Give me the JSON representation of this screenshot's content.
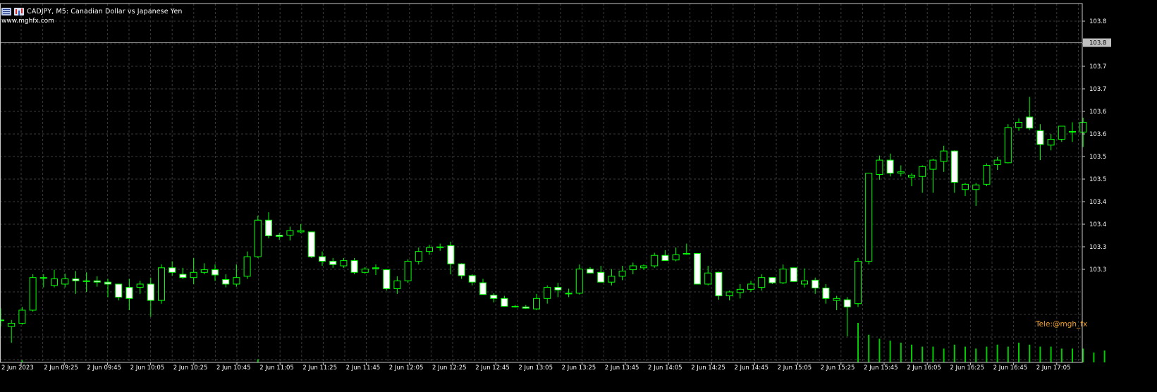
{
  "header": {
    "symbol_title": "CADJPY, M5:  Canadian Dollar vs Japanese Yen",
    "menu_icon": "window-menu-icon",
    "chart_icon": "chart-type-icon"
  },
  "site_label": "www.mghfx.com",
  "watermark": "Tele:@mgh_fx",
  "colors": {
    "background": "#000000",
    "grid": "#3a3a3a",
    "candle_up_fill": "#000000",
    "candle_down_fill": "#ffffff",
    "candle_outline": "#00ff00",
    "volume": "#00cc00",
    "axis_text": "#ffffff",
    "price_tag_bg": "#c0c0c0"
  },
  "price_axis": {
    "labels": [
      "103.8",
      "103.8",
      "103.7",
      "103.7",
      "103.6",
      "103.6",
      "103.5",
      "103.5",
      "103.4",
      "103.4",
      "103.3",
      "103.3"
    ],
    "current_price_label": "103.8"
  },
  "time_axis": {
    "labels": [
      "2 Jun 2023",
      "2 Jun 09:25",
      "2 Jun 09:45",
      "2 Jun 10:05",
      "2 Jun 10:25",
      "2 Jun 10:45",
      "2 Jun 11:05",
      "2 Jun 11:25",
      "2 Jun 11:45",
      "2 Jun 12:05",
      "2 Jun 12:25",
      "2 Jun 12:45",
      "2 Jun 13:05",
      "2 Jun 13:25",
      "2 Jun 13:45",
      "2 Jun 14:05",
      "2 Jun 14:25",
      "2 Jun 14:45",
      "2 Jun 15:05",
      "2 Jun 15:25",
      "2 Jun 15:45",
      "2 Jun 16:05",
      "2 Jun 16:25",
      "2 Jun 16:45",
      "2 Jun 17:05"
    ]
  },
  "chart_data": {
    "type": "candlestick",
    "title": "CADJPY, M5:  Canadian Dollar vs Japanese Yen",
    "ylim": [
      103.29,
      103.84
    ],
    "grid": true,
    "current_price": 103.78,
    "candles": [
      {
        "o": 103.355,
        "h": 103.373,
        "l": 103.345,
        "c": 103.355
      },
      {
        "o": 103.345,
        "h": 103.355,
        "l": 103.32,
        "c": 103.35
      },
      {
        "o": 103.35,
        "h": 103.375,
        "l": 103.348,
        "c": 103.37
      },
      {
        "o": 103.37,
        "h": 103.425,
        "l": 103.368,
        "c": 103.42
      },
      {
        "o": 103.42,
        "h": 103.425,
        "l": 103.405,
        "c": 103.42
      },
      {
        "o": 103.408,
        "h": 103.432,
        "l": 103.405,
        "c": 103.418
      },
      {
        "o": 103.41,
        "h": 103.426,
        "l": 103.405,
        "c": 103.418
      },
      {
        "o": 103.418,
        "h": 103.43,
        "l": 103.395,
        "c": 103.415
      },
      {
        "o": 103.415,
        "h": 103.428,
        "l": 103.398,
        "c": 103.414
      },
      {
        "o": 103.415,
        "h": 103.422,
        "l": 103.406,
        "c": 103.413
      },
      {
        "o": 103.413,
        "h": 103.418,
        "l": 103.39,
        "c": 103.41
      },
      {
        "o": 103.41,
        "h": 103.41,
        "l": 103.385,
        "c": 103.39
      },
      {
        "o": 103.405,
        "h": 103.418,
        "l": 103.37,
        "c": 103.388
      },
      {
        "o": 103.405,
        "h": 103.415,
        "l": 103.395,
        "c": 103.41
      },
      {
        "o": 103.41,
        "h": 103.42,
        "l": 103.36,
        "c": 103.385
      },
      {
        "o": 103.385,
        "h": 103.44,
        "l": 103.38,
        "c": 103.435
      },
      {
        "o": 103.435,
        "h": 103.445,
        "l": 103.423,
        "c": 103.428
      },
      {
        "o": 103.425,
        "h": 103.435,
        "l": 103.418,
        "c": 103.42
      },
      {
        "o": 103.42,
        "h": 103.45,
        "l": 103.41,
        "c": 103.428
      },
      {
        "o": 103.428,
        "h": 103.442,
        "l": 103.425,
        "c": 103.432
      },
      {
        "o": 103.432,
        "h": 103.44,
        "l": 103.415,
        "c": 103.424
      },
      {
        "o": 103.417,
        "h": 103.425,
        "l": 103.405,
        "c": 103.41
      },
      {
        "o": 103.41,
        "h": 103.44,
        "l": 103.406,
        "c": 103.42
      },
      {
        "o": 103.422,
        "h": 103.46,
        "l": 103.418,
        "c": 103.452
      },
      {
        "o": 103.452,
        "h": 103.515,
        "l": 103.45,
        "c": 103.508
      },
      {
        "o": 103.508,
        "h": 103.52,
        "l": 103.48,
        "c": 103.484
      },
      {
        "o": 103.485,
        "h": 103.488,
        "l": 103.478,
        "c": 103.483
      },
      {
        "o": 103.485,
        "h": 103.498,
        "l": 103.477,
        "c": 103.492
      },
      {
        "o": 103.49,
        "h": 103.502,
        "l": 103.488,
        "c": 103.492
      },
      {
        "o": 103.49,
        "h": 103.49,
        "l": 103.45,
        "c": 103.452
      },
      {
        "o": 103.452,
        "h": 103.46,
        "l": 103.438,
        "c": 103.445
      },
      {
        "o": 103.445,
        "h": 103.45,
        "l": 103.435,
        "c": 103.44
      },
      {
        "o": 103.438,
        "h": 103.45,
        "l": 103.435,
        "c": 103.446
      },
      {
        "o": 103.446,
        "h": 103.45,
        "l": 103.425,
        "c": 103.428
      },
      {
        "o": 103.428,
        "h": 103.436,
        "l": 103.426,
        "c": 103.433
      },
      {
        "o": 103.434,
        "h": 103.44,
        "l": 103.424,
        "c": 103.435
      },
      {
        "o": 103.432,
        "h": 103.432,
        "l": 103.4,
        "c": 103.403
      },
      {
        "o": 103.403,
        "h": 103.422,
        "l": 103.395,
        "c": 103.415
      },
      {
        "o": 103.415,
        "h": 103.448,
        "l": 103.412,
        "c": 103.445
      },
      {
        "o": 103.445,
        "h": 103.466,
        "l": 103.44,
        "c": 103.46
      },
      {
        "o": 103.46,
        "h": 103.47,
        "l": 103.455,
        "c": 103.466
      },
      {
        "o": 103.466,
        "h": 103.472,
        "l": 103.461,
        "c": 103.467
      },
      {
        "o": 103.469,
        "h": 103.475,
        "l": 103.425,
        "c": 103.441
      },
      {
        "o": 103.441,
        "h": 103.442,
        "l": 103.418,
        "c": 103.423
      },
      {
        "o": 103.423,
        "h": 103.425,
        "l": 103.408,
        "c": 103.413
      },
      {
        "o": 103.412,
        "h": 103.418,
        "l": 103.395,
        "c": 103.394
      },
      {
        "o": 103.393,
        "h": 103.396,
        "l": 103.382,
        "c": 103.388
      },
      {
        "o": 103.388,
        "h": 103.392,
        "l": 103.376,
        "c": 103.376
      },
      {
        "o": 103.375,
        "h": 103.378,
        "l": 103.374,
        "c": 103.376
      },
      {
        "o": 103.375,
        "h": 103.378,
        "l": 103.372,
        "c": 103.373
      },
      {
        "o": 103.372,
        "h": 103.395,
        "l": 103.37,
        "c": 103.388
      },
      {
        "o": 103.388,
        "h": 103.408,
        "l": 103.38,
        "c": 103.405
      },
      {
        "o": 103.405,
        "h": 103.412,
        "l": 103.39,
        "c": 103.401
      },
      {
        "o": 103.396,
        "h": 103.403,
        "l": 103.39,
        "c": 103.396
      },
      {
        "o": 103.396,
        "h": 103.44,
        "l": 103.394,
        "c": 103.433
      },
      {
        "o": 103.433,
        "h": 103.436,
        "l": 103.427,
        "c": 103.427
      },
      {
        "o": 103.428,
        "h": 103.438,
        "l": 103.413,
        "c": 103.413
      },
      {
        "o": 103.413,
        "h": 103.433,
        "l": 103.408,
        "c": 103.422
      },
      {
        "o": 103.422,
        "h": 103.438,
        "l": 103.416,
        "c": 103.43
      },
      {
        "o": 103.432,
        "h": 103.443,
        "l": 103.425,
        "c": 103.438
      },
      {
        "o": 103.435,
        "h": 103.44,
        "l": 103.432,
        "c": 103.438
      },
      {
        "o": 103.438,
        "h": 103.458,
        "l": 103.435,
        "c": 103.454
      },
      {
        "o": 103.454,
        "h": 103.462,
        "l": 103.446,
        "c": 103.446
      },
      {
        "o": 103.447,
        "h": 103.466,
        "l": 103.445,
        "c": 103.455
      },
      {
        "o": 103.457,
        "h": 103.472,
        "l": 103.455,
        "c": 103.456
      },
      {
        "o": 103.457,
        "h": 103.457,
        "l": 103.41,
        "c": 103.41
      },
      {
        "o": 103.41,
        "h": 103.438,
        "l": 103.408,
        "c": 103.427
      },
      {
        "o": 103.428,
        "h": 103.429,
        "l": 103.386,
        "c": 103.392
      },
      {
        "o": 103.392,
        "h": 103.4,
        "l": 103.385,
        "c": 103.398
      },
      {
        "o": 103.397,
        "h": 103.41,
        "l": 103.388,
        "c": 103.402
      },
      {
        "o": 103.402,
        "h": 103.415,
        "l": 103.398,
        "c": 103.41
      },
      {
        "o": 103.405,
        "h": 103.425,
        "l": 103.4,
        "c": 103.42
      },
      {
        "o": 103.42,
        "h": 103.42,
        "l": 103.41,
        "c": 103.412
      },
      {
        "o": 103.412,
        "h": 103.44,
        "l": 103.41,
        "c": 103.433
      },
      {
        "o": 103.435,
        "h": 103.435,
        "l": 103.414,
        "c": 103.414
      },
      {
        "o": 103.41,
        "h": 103.434,
        "l": 103.405,
        "c": 103.415
      },
      {
        "o": 103.416,
        "h": 103.42,
        "l": 103.395,
        "c": 103.404
      },
      {
        "o": 103.404,
        "h": 103.41,
        "l": 103.38,
        "c": 103.388
      },
      {
        "o": 103.385,
        "h": 103.392,
        "l": 103.37,
        "c": 103.388
      },
      {
        "o": 103.386,
        "h": 103.39,
        "l": 103.33,
        "c": 103.375
      },
      {
        "o": 103.38,
        "h": 103.45,
        "l": 103.375,
        "c": 103.445
      },
      {
        "o": 103.445,
        "h": 103.58,
        "l": 103.44,
        "c": 103.58
      },
      {
        "o": 103.578,
        "h": 103.607,
        "l": 103.57,
        "c": 103.6
      },
      {
        "o": 103.6,
        "h": 103.61,
        "l": 103.575,
        "c": 103.58
      },
      {
        "o": 103.58,
        "h": 103.592,
        "l": 103.575,
        "c": 103.582
      },
      {
        "o": 103.574,
        "h": 103.58,
        "l": 103.56,
        "c": 103.577
      },
      {
        "o": 103.575,
        "h": 103.592,
        "l": 103.55,
        "c": 103.59
      },
      {
        "o": 103.586,
        "h": 103.602,
        "l": 103.55,
        "c": 103.6
      },
      {
        "o": 103.598,
        "h": 103.622,
        "l": 103.582,
        "c": 103.614
      },
      {
        "o": 103.614,
        "h": 103.615,
        "l": 103.55,
        "c": 103.566
      },
      {
        "o": 103.555,
        "h": 103.565,
        "l": 103.545,
        "c": 103.563
      },
      {
        "o": 103.555,
        "h": 103.565,
        "l": 103.53,
        "c": 103.562
      },
      {
        "o": 103.563,
        "h": 103.595,
        "l": 103.56,
        "c": 103.592
      },
      {
        "o": 103.593,
        "h": 103.605,
        "l": 103.585,
        "c": 103.6
      },
      {
        "o": 103.596,
        "h": 103.655,
        "l": 103.595,
        "c": 103.65
      },
      {
        "o": 103.65,
        "h": 103.664,
        "l": 103.645,
        "c": 103.658
      },
      {
        "o": 103.666,
        "h": 103.697,
        "l": 103.646,
        "c": 103.649
      },
      {
        "o": 103.645,
        "h": 103.655,
        "l": 103.6,
        "c": 103.624
      },
      {
        "o": 103.623,
        "h": 103.64,
        "l": 103.615,
        "c": 103.632
      },
      {
        "o": 103.632,
        "h": 103.652,
        "l": 103.628,
        "c": 103.652
      },
      {
        "o": 103.644,
        "h": 103.658,
        "l": 103.628,
        "c": 103.644
      },
      {
        "o": 103.643,
        "h": 103.665,
        "l": 103.62,
        "c": 103.658
      }
    ],
    "volume_max": 100,
    "volume": [
      0,
      0,
      5,
      0,
      0,
      0,
      0,
      0,
      0,
      0,
      0,
      0,
      0,
      0,
      0,
      0,
      0,
      0,
      0,
      0,
      0,
      0,
      0,
      0,
      8,
      0,
      0,
      0,
      0,
      0,
      0,
      0,
      0,
      0,
      0,
      0,
      0,
      0,
      0,
      0,
      0,
      0,
      0,
      0,
      0,
      0,
      0,
      0,
      0,
      0,
      0,
      0,
      0,
      0,
      0,
      0,
      0,
      0,
      0,
      0,
      0,
      0,
      0,
      0,
      0,
      0,
      0,
      0,
      0,
      0,
      0,
      0,
      0,
      0,
      0,
      0,
      0,
      0,
      0,
      0,
      100,
      70,
      60,
      55,
      50,
      45,
      40,
      40,
      35,
      45,
      40,
      35,
      40,
      45,
      40,
      50,
      45,
      40,
      40,
      35,
      35,
      35,
      25,
      30
    ]
  }
}
